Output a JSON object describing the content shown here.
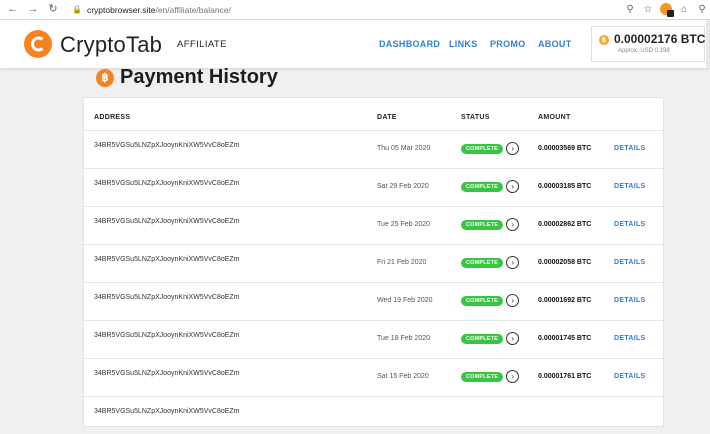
{
  "browser": {
    "url_host": "cryptobrowser.site",
    "url_path": "/en/affiliate/balance/"
  },
  "header": {
    "logo_text": "CryptoTab",
    "logo_sub": "AFFILIATE",
    "nav": [
      "DASHBOARD",
      "LINKS",
      "PROMO",
      "ABOUT"
    ],
    "balance": "0.00002176 BTC",
    "balance_approx": "Approx. USD 0.198"
  },
  "page": {
    "title": "Payment History"
  },
  "table": {
    "headers": {
      "address": "ADDRESS",
      "date": "DATE",
      "status": "STATUS",
      "amount": "AMOUNT"
    },
    "rows": [
      {
        "address": "34BR5VGSu5LNZpXJooynKniXW5VvC8oEZm",
        "date": "Thu 05 Mar 2020",
        "status": "COMPLETE",
        "amount": "0.00003569 BTC",
        "details": "DETAILS"
      },
      {
        "address": "34BR5VGSu5LNZpXJooynKniXW5VvC8oEZm",
        "date": "Sat 29 Feb 2020",
        "status": "COMPLETE",
        "amount": "0.00003185 BTC",
        "details": "DETAILS"
      },
      {
        "address": "34BR5VGSu5LNZpXJooynKniXW5VvC8oEZm",
        "date": "Tue 25 Feb 2020",
        "status": "COMPLETE",
        "amount": "0.00002862 BTC",
        "details": "DETAILS"
      },
      {
        "address": "34BR5VGSu5LNZpXJooynKniXW5VvC8oEZm",
        "date": "Fri 21 Feb 2020",
        "status": "COMPLETE",
        "amount": "0.00002058 BTC",
        "details": "DETAILS"
      },
      {
        "address": "34BR5VGSu5LNZpXJooynKniXW5VvC8oEZm",
        "date": "Wed 19 Feb 2020",
        "status": "COMPLETE",
        "amount": "0.00001692 BTC",
        "details": "DETAILS"
      },
      {
        "address": "34BR5VGSu5LNZpXJooynKniXW5VvC8oEZm",
        "date": "Tue 18 Feb 2020",
        "status": "COMPLETE",
        "amount": "0.00001745 BTC",
        "details": "DETAILS"
      },
      {
        "address": "34BR5VGSu5LNZpXJooynKniXW5VvC8oEZm",
        "date": "Sat 15 Feb 2020",
        "status": "COMPLETE",
        "amount": "0.00001761 BTC",
        "details": "DETAILS"
      },
      {
        "address": "34BR5VGSu5LNZpXJooynKniXW5VvC8oEZm",
        "date": "",
        "status": "",
        "amount": "",
        "details": ""
      }
    ]
  },
  "colors": {
    "brand_orange": "#f5841f",
    "link_blue": "#2c7fd6",
    "status_green": "#37c543"
  }
}
